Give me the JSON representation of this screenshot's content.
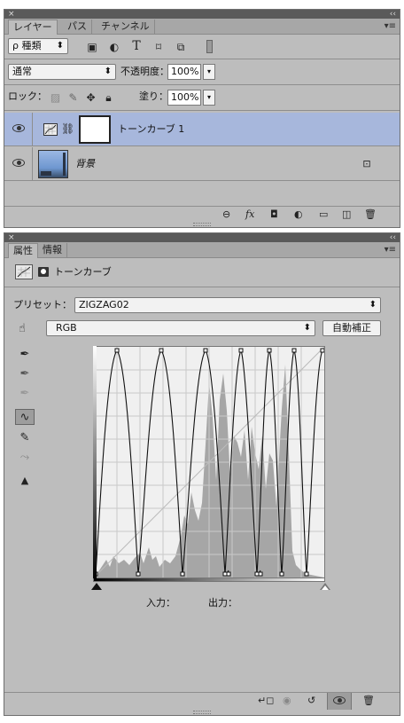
{
  "layers_panel": {
    "close": "×",
    "collapse": "‹‹",
    "tabs": [
      "レイヤー",
      "パス",
      "チャンネル"
    ],
    "menu": "▾≡",
    "filter": {
      "label": "ρ 種類",
      "arrow": "⬍"
    },
    "filter_icons": [
      "image-filter-icon",
      "adjustment-filter-icon",
      "type-filter-icon",
      "shape-filter-icon",
      "smart-object-filter-icon",
      "filter-toggle-icon"
    ],
    "blend_mode": "通常",
    "opacity_label": "不透明度：",
    "opacity_value": "100%",
    "lock_label": "ロック：",
    "fill_label": "塗り：",
    "fill_value": "100%",
    "layers": [
      {
        "name": "トーンカーブ 1",
        "selected": true,
        "type": "adjustment"
      },
      {
        "name": "背景",
        "selected": false,
        "type": "background",
        "locked": true
      }
    ],
    "footer_icons": [
      "link-layers-icon",
      "fx-icon",
      "add-mask-icon",
      "new-fill-adjustment-icon",
      "new-group-icon",
      "new-layer-icon",
      "delete-icon"
    ],
    "fx_label": "fx"
  },
  "properties_panel": {
    "close": "×",
    "collapse": "‹‹",
    "tabs": [
      "属性",
      "情報"
    ],
    "menu": "▾≡",
    "header_title": "トーンカーブ",
    "preset_label": "プリセット：",
    "preset_value": "ZIGZAG02",
    "channel_value": "RGB",
    "auto_label": "自動補正",
    "input_label": "入力：",
    "output_label": "出力：",
    "footer_icons": [
      "clip-to-layer-icon",
      "view-previous-icon",
      "reset-icon",
      "visibility-icon",
      "delete-icon"
    ]
  },
  "colors": {
    "panel_bg": "#bdbdbd",
    "selected_layer": "#a7b7dc",
    "curve_bg": "#f0f0f0",
    "histogram": "#a6a6a6"
  }
}
